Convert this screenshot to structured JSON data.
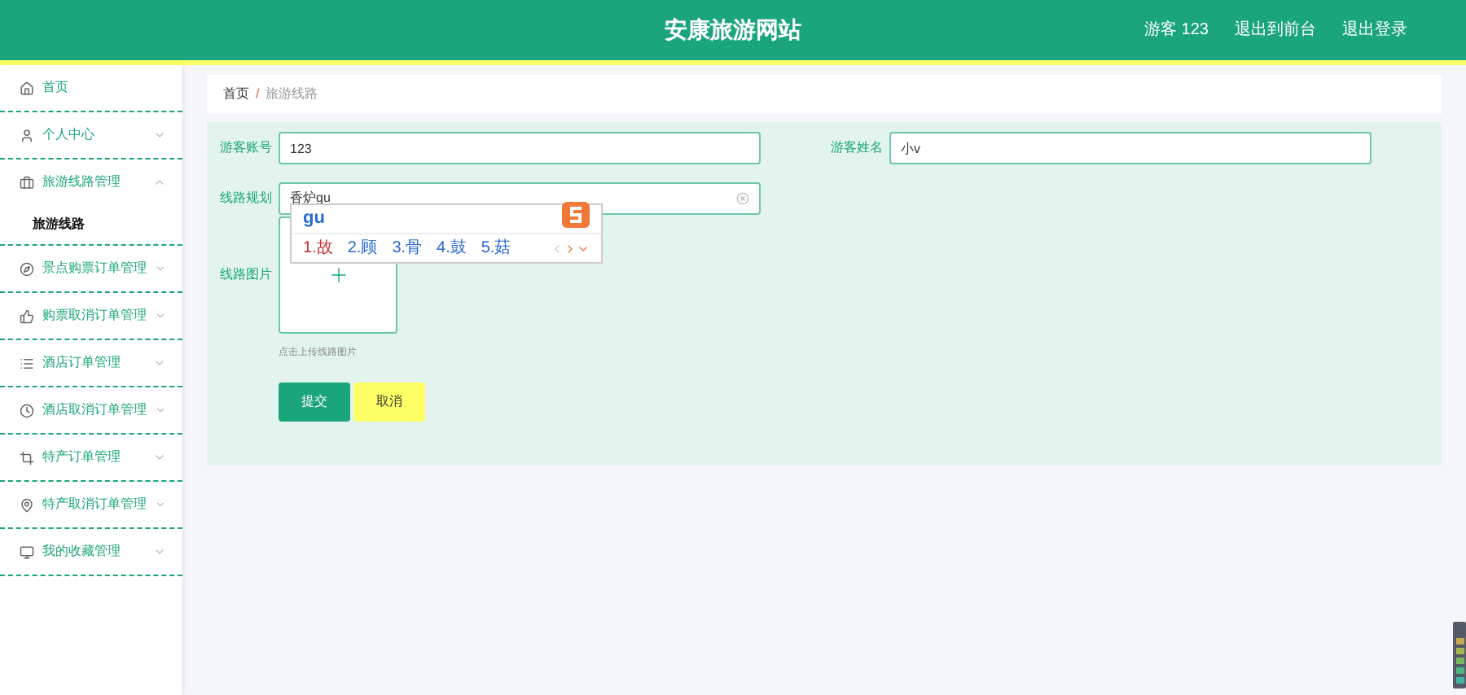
{
  "header": {
    "title": "安康旅游网站",
    "user": "游客 123",
    "links": [
      "退出到前台",
      "退出登录"
    ]
  },
  "sidebar": {
    "items": [
      {
        "label": "首页"
      },
      {
        "label": "个人中心",
        "expanded": false
      },
      {
        "label": "旅游线路管理",
        "expanded": true,
        "children": [
          {
            "label": "旅游线路",
            "selected": true
          }
        ]
      },
      {
        "label": "景点购票订单管理",
        "expanded": false
      },
      {
        "label": "购票取消订单管理",
        "expanded": false
      },
      {
        "label": "酒店订单管理",
        "expanded": false
      },
      {
        "label": "酒店取消订单管理",
        "expanded": false
      },
      {
        "label": "特产订单管理",
        "expanded": false
      },
      {
        "label": "特产取消订单管理",
        "expanded": false
      },
      {
        "label": "我的收藏管理",
        "expanded": false
      }
    ]
  },
  "breadcrumb": {
    "items": [
      "首页",
      "旅游线路"
    ],
    "separator": "/"
  },
  "form": {
    "account": {
      "label": "游客账号",
      "value": "123"
    },
    "name": {
      "label": "游客姓名",
      "value": "小v"
    },
    "route": {
      "label": "线路规划",
      "value": "香炉gu"
    },
    "image": {
      "label": "线路图片",
      "hint": "点击上传线路图片"
    },
    "buttons": [
      {
        "label": "提交",
        "kind": "primary"
      },
      {
        "label": "取消",
        "kind": "cancel"
      }
    ]
  },
  "ime": {
    "input": "gu",
    "candidates": [
      "1.故",
      "2.顾",
      "3.骨",
      "4.鼓",
      "5.菇"
    ]
  }
}
